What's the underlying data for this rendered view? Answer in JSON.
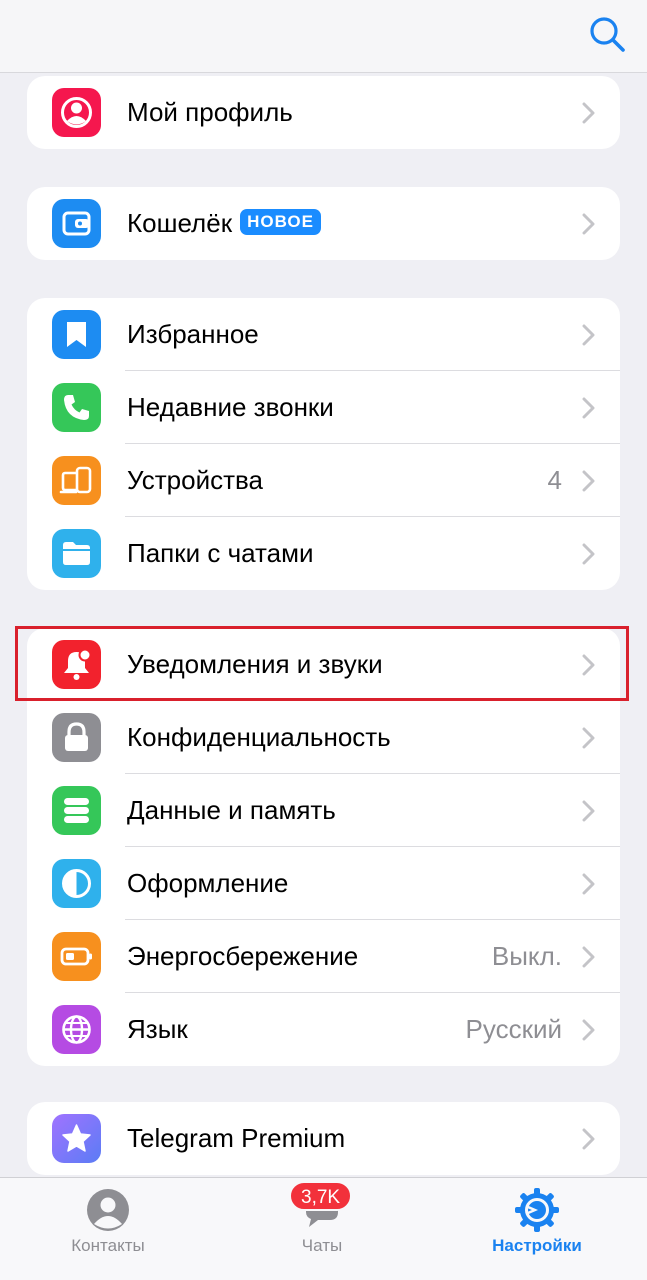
{
  "header": {
    "search_icon": "search-icon"
  },
  "groups": {
    "profile": {
      "items": [
        {
          "label": "Мой профиль",
          "icon": "person-icon",
          "color": "#f5174e"
        }
      ]
    },
    "wallet": {
      "items": [
        {
          "label": "Кошелёк",
          "badge": "НОВОЕ",
          "icon": "wallet-icon",
          "color": "#1d8cf2"
        }
      ]
    },
    "main": {
      "items": [
        {
          "label": "Избранное",
          "icon": "bookmark-icon",
          "color": "#1d8cf2"
        },
        {
          "label": "Недавние звонки",
          "icon": "phone-icon",
          "color": "#35c759"
        },
        {
          "label": "Устройства",
          "value": "4",
          "icon": "devices-icon",
          "color": "#f7901e"
        },
        {
          "label": "Папки с чатами",
          "icon": "folder-icon",
          "color": "#2fb1ec"
        }
      ]
    },
    "settings": {
      "items": [
        {
          "label": "Уведомления и звуки",
          "icon": "bell-icon",
          "color": "#f2222d"
        },
        {
          "label": "Конфиденциальность",
          "icon": "lock-icon",
          "color": "#8e8e93"
        },
        {
          "label": "Данные и память",
          "icon": "database-icon",
          "color": "#35c759"
        },
        {
          "label": "Оформление",
          "icon": "appearance-icon",
          "color": "#2fb1ec"
        },
        {
          "label": "Энергосбережение",
          "value": "Выкл.",
          "icon": "battery-icon",
          "color": "#f7901e"
        },
        {
          "label": "Язык",
          "value": "Русский",
          "icon": "globe-icon",
          "color": "#b54be3"
        }
      ]
    },
    "premium": {
      "items": [
        {
          "label": "Telegram Premium",
          "icon": "star-icon",
          "color": "#8b6cf6"
        }
      ]
    }
  },
  "tabbar": {
    "tabs": [
      {
        "label": "Контакты",
        "icon": "contacts-icon"
      },
      {
        "label": "Чаты",
        "badge": "3,7K",
        "icon": "chats-icon"
      },
      {
        "label": "Настройки",
        "icon": "settings-gear-icon",
        "active": true
      }
    ]
  },
  "colors": {
    "accent": "#1a82f0",
    "highlight_border": "#d9202c",
    "badge_red": "#f2313b"
  }
}
